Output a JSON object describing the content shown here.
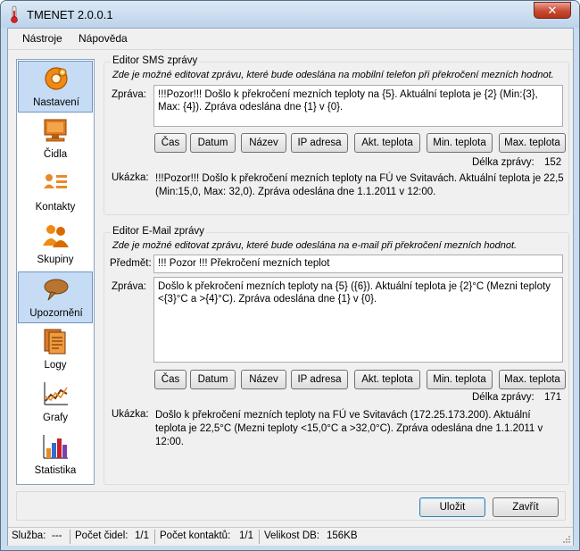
{
  "window": {
    "title": "TMENET 2.0.0.1",
    "close_glyph": "✕"
  },
  "menu": {
    "items": [
      "Nástroje",
      "Nápověda"
    ]
  },
  "sidebar": {
    "items": [
      {
        "label": "Nastavení",
        "icon": "settings-icon",
        "selected": true
      },
      {
        "label": "Čidla",
        "icon": "monitor-icon",
        "selected": false
      },
      {
        "label": "Kontakty",
        "icon": "contact-card-icon",
        "selected": false
      },
      {
        "label": "Skupiny",
        "icon": "group-icon",
        "selected": false
      },
      {
        "label": "Upozornění",
        "icon": "speech-bubble-icon",
        "selected": true
      },
      {
        "label": "Logy",
        "icon": "logs-icon",
        "selected": false
      },
      {
        "label": "Grafy",
        "icon": "line-graph-icon",
        "selected": false
      },
      {
        "label": "Statistika",
        "icon": "bar-chart-icon",
        "selected": false
      }
    ]
  },
  "sms_editor": {
    "title": "Editor SMS zprávy",
    "hint": "Zde je možné editovat zprávu, které bude odeslána na mobilní telefon při překročení mezních hodnot.",
    "message_label": "Zpráva:",
    "message_value": "!!!Pozor!!! Došlo k překročení mezních teploty na {5}. Aktuální teplota je {2} (Min:{3}, Max: {4}). Zpráva odeslána dne {1} v {0}.",
    "buttons": [
      "Čas",
      "Datum",
      "Název",
      "IP adresa",
      "Akt. teplota",
      "Min. teplota",
      "Max. teplota"
    ],
    "length_label": "Délka zprávy:",
    "length_value": "152",
    "preview_label": "Ukázka:",
    "preview_value": "!!!Pozor!!! Došlo k překročení mezních teploty na FÚ ve Svitavách. Aktuální teplota je 22,5 (Min:15,0, Max: 32,0). Zpráva odeslána dne 1.1.2011 v 12:00."
  },
  "email_editor": {
    "title": "Editor E-Mail zprávy",
    "hint": "Zde je možné editovat zprávu, které bude odeslána na e-mail při překročení mezních hodnot.",
    "subject_label": "Předmět:",
    "subject_value": "!!! Pozor !!! Překročení mezních teplot",
    "message_label": "Zpráva:",
    "message_value": "Došlo k překročení mezních teploty na {5} ({6}). Aktuální teplota je {2}°C (Mezni teploty <{3}°C a >{4}°C). Zpráva odeslána dne {1} v {0}.",
    "buttons": [
      "Čas",
      "Datum",
      "Název",
      "IP adresa",
      "Akt. teplota",
      "Min. teplota",
      "Max. teplota"
    ],
    "length_label": "Délka zprávy:",
    "length_value": "171",
    "preview_label": "Ukázka:",
    "preview_value": "Došlo k překročení mezních teploty na FÚ ve Svitavách (172.25.173.200). Aktuální teplota je 22,5°C (Mezni teploty <15,0°C a >32,0°C). Zpráva odeslána dne 1.1.2011 v 12:00."
  },
  "actions": {
    "save_label": "Uložit",
    "close_label": "Zavřít"
  },
  "status": {
    "service_label": "Služba:",
    "service_value": "---",
    "sensors_label": "Počet čidel:",
    "sensors_value": "1/1",
    "contacts_label": "Počet kontaktů:",
    "contacts_value": "1/1",
    "db_label": "Velikost DB:",
    "db_value": "156KB"
  }
}
